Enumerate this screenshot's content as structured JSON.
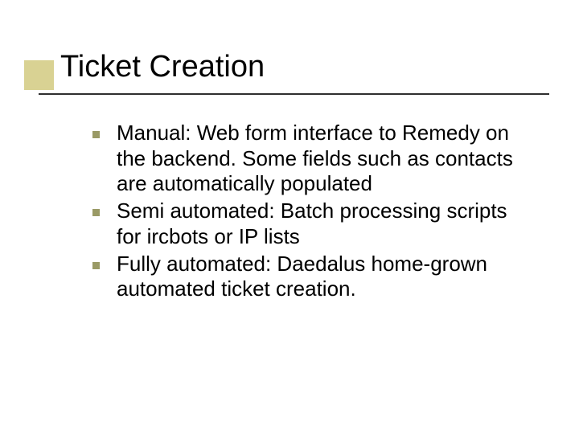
{
  "slide": {
    "title": "Ticket Creation",
    "bullets": [
      "Manual: Web form interface to Remedy on the backend.  Some fields such as contacts are automatically populated",
      "Semi automated: Batch processing scripts for ircbots or IP lists",
      "Fully automated: Daedalus home-grown automated ticket creation."
    ]
  }
}
